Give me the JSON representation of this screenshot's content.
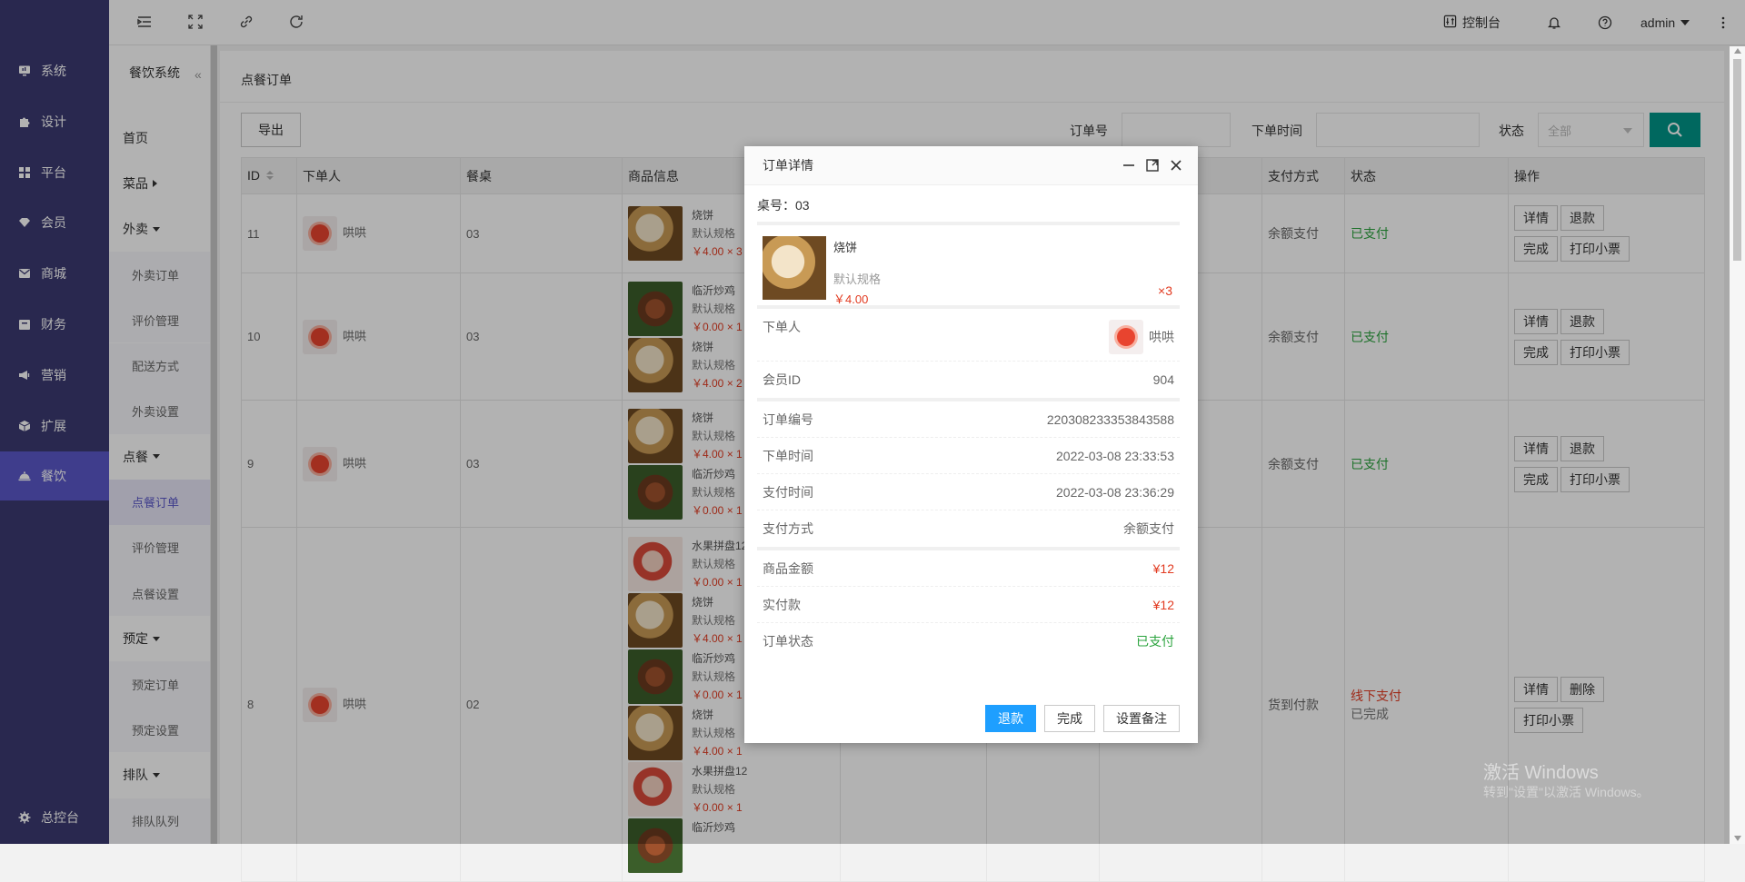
{
  "leftnav": {
    "items": [
      {
        "label": "系统",
        "icon": "monitor-icon"
      },
      {
        "label": "设计",
        "icon": "puzzle-icon"
      },
      {
        "label": "平台",
        "icon": "grid-icon"
      },
      {
        "label": "会员",
        "icon": "diamond-icon"
      },
      {
        "label": "商城",
        "icon": "mail-icon"
      },
      {
        "label": "财务",
        "icon": "wallet-icon"
      },
      {
        "label": "营销",
        "icon": "megaphone-icon"
      },
      {
        "label": "扩展",
        "icon": "cube-icon"
      },
      {
        "label": "餐饮",
        "icon": "food-cover-icon"
      }
    ],
    "active": "餐饮",
    "bottom_label": "总控台"
  },
  "subnav": {
    "title": "餐饮系统",
    "items": [
      {
        "label": "首页",
        "type": "group"
      },
      {
        "label": "菜品",
        "type": "group-right"
      },
      {
        "label": "外卖",
        "type": "group-down"
      },
      {
        "label": "外卖订单",
        "type": "child"
      },
      {
        "label": "评价管理",
        "type": "child"
      },
      {
        "label": "配送方式",
        "type": "child"
      },
      {
        "label": "外卖设置",
        "type": "child"
      },
      {
        "label": "点餐",
        "type": "group-down"
      },
      {
        "label": "点餐订单",
        "type": "child-active"
      },
      {
        "label": "评价管理",
        "type": "child"
      },
      {
        "label": "点餐设置",
        "type": "child"
      },
      {
        "label": "预定",
        "type": "group-down"
      },
      {
        "label": "预定订单",
        "type": "child"
      },
      {
        "label": "预定设置",
        "type": "child"
      },
      {
        "label": "排队",
        "type": "group-down"
      },
      {
        "label": "排队队列",
        "type": "child"
      }
    ]
  },
  "topbar": {
    "console_label": "控制台",
    "user_label": "admin"
  },
  "page": {
    "title": "点餐订单",
    "export_label": "导出",
    "filters": {
      "order_no_label": "订单号",
      "time_label": "下单时间",
      "status_label": "状态",
      "status_value": "全部"
    }
  },
  "table": {
    "headers": [
      "ID",
      "下单人",
      "餐桌",
      "商品信息",
      "",
      "",
      "",
      "支付方式",
      "状态",
      "操作"
    ],
    "rows": [
      {
        "id": "11",
        "user": "哄哄",
        "table": "03",
        "goods": [
          {
            "img": "bing",
            "name": "烧饼",
            "spec": "默认规格",
            "price": "￥4.00 × 3"
          }
        ],
        "pay": "余额支付",
        "status": "已支付",
        "status2": "",
        "status_style": "paid",
        "actions": [
          "详情",
          "退款",
          "完成",
          "打印小票"
        ]
      },
      {
        "id": "10",
        "user": "哄哄",
        "table": "03",
        "goods": [
          {
            "img": "ji",
            "name": "临沂炒鸡",
            "spec": "默认规格",
            "price": "￥0.00 × 1"
          },
          {
            "img": "bing",
            "name": "烧饼",
            "spec": "默认规格",
            "price": "￥4.00 × 2"
          }
        ],
        "pay": "余额支付",
        "status": "已支付",
        "status2": "",
        "status_style": "paid",
        "actions": [
          "详情",
          "退款",
          "完成",
          "打印小票"
        ]
      },
      {
        "id": "9",
        "user": "哄哄",
        "table": "03",
        "goods": [
          {
            "img": "bing",
            "name": "烧饼",
            "spec": "默认规格",
            "price": "￥4.00 × 1"
          },
          {
            "img": "ji",
            "name": "临沂炒鸡",
            "spec": "默认规格",
            "price": "￥0.00 × 1"
          }
        ],
        "pay": "余额支付",
        "status": "已支付",
        "status2": "",
        "status_style": "paid",
        "actions": [
          "详情",
          "退款",
          "完成",
          "打印小票"
        ]
      },
      {
        "id": "8",
        "user": "哄哄",
        "table": "02",
        "goods": [
          {
            "img": "fruit",
            "name": "水果拼盘12",
            "spec": "默认规格",
            "price": "￥0.00 × 1"
          },
          {
            "img": "bing",
            "name": "烧饼",
            "spec": "默认规格",
            "price": "￥4.00 × 1"
          },
          {
            "img": "ji",
            "name": "临沂炒鸡",
            "spec": "默认规格",
            "price": "￥0.00 × 1"
          },
          {
            "img": "bing",
            "name": "烧饼",
            "spec": "默认规格",
            "price": "￥4.00 × 1"
          },
          {
            "img": "fruit",
            "name": "水果拼盘12",
            "spec": "默认规格",
            "price": "￥0.00 × 1"
          },
          {
            "img": "ji",
            "name": "临沂炒鸡",
            "spec": "",
            "price": ""
          }
        ],
        "pay": "货到付款",
        "status": "线下支付",
        "status2": "已完成",
        "status_style": "offline",
        "actions": [
          "详情",
          "删除",
          "打印小票"
        ]
      }
    ]
  },
  "modal": {
    "title": "订单详情",
    "table_label": "桌号：03",
    "product": {
      "name": "烧饼",
      "spec": "默认规格",
      "price": "￥4.00",
      "qty": "×3"
    },
    "user_label": "下单人",
    "user_name": "哄哄",
    "member_id_label": "会员ID",
    "member_id": "904",
    "order_no_label": "订单编号",
    "order_no": "220308233353843588",
    "order_time_label": "下单时间",
    "order_time": "2022-03-08 23:33:53",
    "pay_time_label": "支付时间",
    "pay_time": "2022-03-08 23:36:29",
    "pay_method_label": "支付方式",
    "pay_method": "余额支付",
    "goods_amount_label": "商品金额",
    "goods_amount": "¥12",
    "paid_label": "实付款",
    "paid": "¥12",
    "status_label": "订单状态",
    "status": "已支付",
    "buttons": {
      "refund": "退款",
      "finish": "完成",
      "remark": "设置备注"
    }
  },
  "watermark": {
    "line1": "激活 Windows",
    "line2": "转到\"设置\"以激活 Windows。"
  }
}
